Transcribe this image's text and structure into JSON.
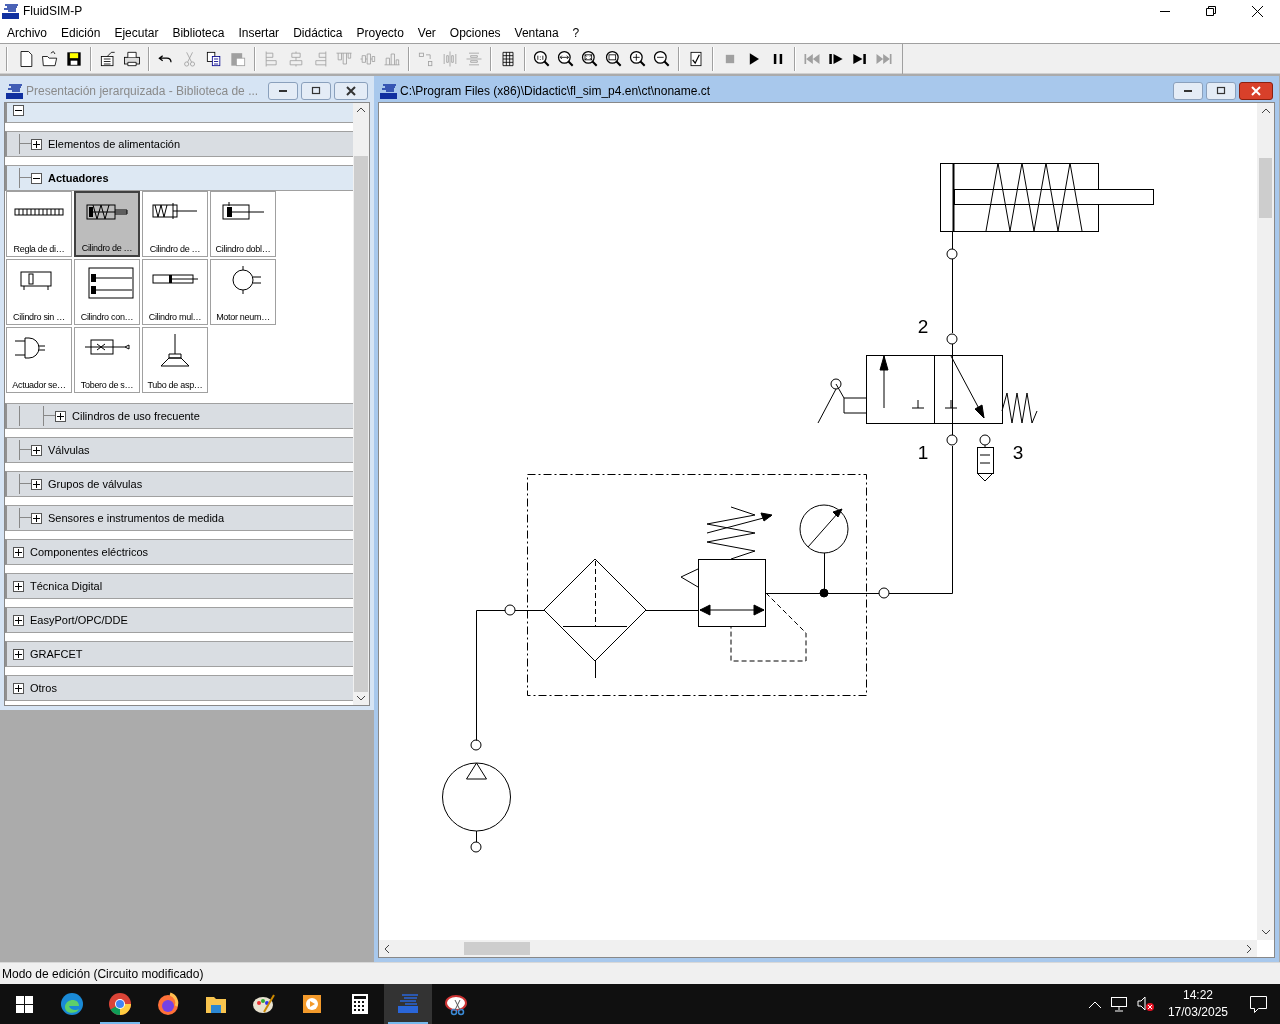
{
  "app": {
    "title": "FluidSIM-P"
  },
  "menu": [
    "Archivo",
    "Edición",
    "Ejecutar",
    "Biblioteca",
    "Insertar",
    "Didáctica",
    "Proyecto",
    "Ver",
    "Opciones",
    "Ventana",
    "?"
  ],
  "toolbar": [
    [
      {
        "disabled": false
      },
      {
        "disabled": false
      },
      {
        "disabled": false
      }
    ],
    [
      {
        "disabled": false
      },
      {
        "disabled": false
      }
    ],
    [
      {
        "disabled": false
      },
      {
        "disabled": true
      },
      {
        "disabled": false
      },
      {
        "disabled": true
      }
    ],
    [
      {
        "disabled": true
      },
      {
        "disabled": true
      },
      {
        "disabled": true
      },
      {
        "disabled": true
      },
      {
        "disabled": true
      },
      {
        "disabled": true
      }
    ],
    [
      {
        "disabled": true
      },
      {
        "disabled": true
      },
      {
        "disabled": true
      }
    ],
    [
      {
        "disabled": false
      }
    ],
    [
      {
        "disabled": false
      },
      {
        "disabled": false
      },
      {
        "disabled": false
      },
      {
        "disabled": false
      },
      {
        "disabled": false
      },
      {
        "disabled": false
      }
    ],
    [
      {
        "disabled": false
      }
    ],
    [
      {
        "disabled": true
      },
      {
        "disabled": false
      },
      {
        "disabled": false
      }
    ],
    [
      {
        "disabled": true
      },
      {
        "disabled": false
      },
      {
        "disabled": false
      },
      {
        "disabled": true
      }
    ]
  ],
  "library_window": {
    "title": "Presentación jerarquizada - Biblioteca de ...",
    "active": false,
    "tree": [
      {
        "expanded": true,
        "children": [
          {
            "label": "Elementos de alimentación",
            "expanded": false
          },
          {
            "label": "Actuadores",
            "expanded": true,
            "tiles": [
              {
                "label": "Regla de di…",
                "selected": false
              },
              {
                "label": "Cilindro de …",
                "selected": true
              },
              {
                "label": "Cilindro de …",
                "selected": false
              },
              {
                "label": "Cilindro dobl…",
                "selected": false
              },
              {
                "label": "Cilindro sin …",
                "selected": false
              },
              {
                "label": "Cilindro con…",
                "selected": false
              },
              {
                "label": "Cilindro mul…",
                "selected": false
              },
              {
                "label": "Motor neum…",
                "selected": false
              },
              {
                "label": "Actuador se…",
                "selected": false
              },
              {
                "label": "Tobero de s…",
                "selected": false
              },
              {
                "label": "Tubo de asp…",
                "selected": false
              }
            ],
            "children": [
              {
                "label": "Cilindros de uso frecuente",
                "expanded": false
              }
            ]
          },
          {
            "label": "Válvulas",
            "expanded": false
          },
          {
            "label": "Grupos de válvulas",
            "expanded": false
          },
          {
            "label": "Sensores e instrumentos de medida",
            "expanded": false
          }
        ]
      },
      {
        "label": "Componentes eléctricos",
        "expanded": false
      },
      {
        "label": "Técnica Digital",
        "expanded": false
      },
      {
        "label": "EasyPort/OPC/DDE",
        "expanded": false
      },
      {
        "label": "GRAFCET",
        "expanded": false
      },
      {
        "label": "Otros",
        "expanded": false
      }
    ]
  },
  "circuit_window": {
    "title": "C:\\Program Files (x86)\\Didactic\\fl_sim_p4.en\\ct\\noname.ct",
    "active": true,
    "port_labels": [
      "2",
      "1",
      "3"
    ]
  },
  "status_bar": "Modo de edición (Circuito modificado)",
  "taskbar": {
    "apps": [
      {
        "running": false,
        "selected": false
      },
      {
        "running": true,
        "selected": false
      },
      {
        "running": false,
        "selected": false
      },
      {
        "running": false,
        "selected": false
      },
      {
        "running": false,
        "selected": false
      },
      {
        "running": false,
        "selected": false
      },
      {
        "running": false,
        "selected": false
      },
      {
        "running": true,
        "selected": true
      },
      {
        "running": false,
        "selected": false
      }
    ],
    "clock": {
      "time": "14:22",
      "date": "17/03/2025"
    }
  }
}
